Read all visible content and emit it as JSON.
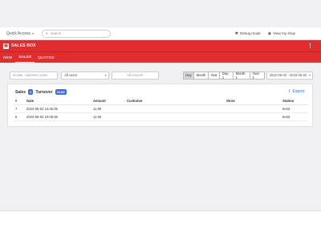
{
  "topbar": {
    "quick_access": "Quick Access",
    "search_placeholder": "search",
    "debug_mode": "Debug mode",
    "view_shop": "View my shop"
  },
  "header": {
    "brand": "SALES BOX"
  },
  "tabs": [
    {
      "label": "NEW",
      "active": false
    },
    {
      "label": "SALES",
      "active": true
    },
    {
      "label": "QUOTES",
      "active": false
    }
  ],
  "filters": {
    "search_placeholder": "Id sale, customer name",
    "users_select": "All users",
    "amount_placeholder": "All Amount",
    "periods": [
      "Day",
      "Month",
      "Year",
      "Day-1",
      "Month-1",
      "Year-1"
    ],
    "active_period": "Day",
    "date_range": "2022-06-02 - 2022-06-02"
  },
  "summary": {
    "sales_label": "Sales",
    "sales_count": "2",
    "turnover_label": "Turnover",
    "turnover_value": "23.80",
    "export_label": "Export"
  },
  "table": {
    "columns": [
      "#",
      "Date",
      "Amount",
      "Customer",
      "Store",
      "Station"
    ],
    "rows": [
      {
        "id": "7",
        "date": "2022-06-02 14:45:45",
        "amount": "11.90",
        "customer": "",
        "store": "",
        "station": "test3"
      },
      {
        "id": "6",
        "date": "2022-06-02 10:09:26",
        "amount": "11.90",
        "customer": "",
        "store": "",
        "station": "test3"
      }
    ]
  },
  "colors": {
    "brand_red": "#e12d2d",
    "badge_blue": "#3c6df0",
    "link_blue": "#2b6fd6"
  }
}
